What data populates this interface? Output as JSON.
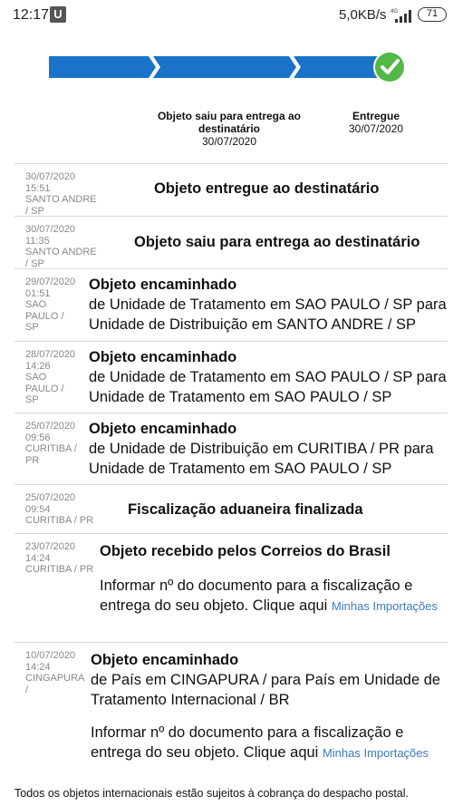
{
  "status_bar": {
    "time": "12:17",
    "app_badge": "U",
    "speed": "5,0KB/s",
    "network": "4G",
    "battery": "71"
  },
  "progress": {
    "completed_segments": 3,
    "total_segments": 3,
    "complete": true,
    "color": "#1a73c8",
    "check_color": "#52b848"
  },
  "steps": [
    {
      "title": "Objeto saiu para entrega ao destinatário",
      "date": "30/07/2020"
    },
    {
      "title": "Entregue",
      "date": "30/07/2020"
    }
  ],
  "events": [
    {
      "date": "30/07/2020",
      "time": "15:51",
      "location": "SANTO ANDRE / SP",
      "title": "Objeto entregue ao destinatário"
    },
    {
      "date": "30/07/2020",
      "time": "11:35",
      "location": "SANTO ANDRE / SP",
      "title": "Objeto saiu para entrega ao destinatário"
    },
    {
      "date": "29/07/2020",
      "time": "01:51",
      "location": "SAO PAULO / SP",
      "title": "Objeto encaminhado",
      "detail": "de Unidade de Tratamento em SAO PAULO / SP para Unidade de Distribuição em SANTO ANDRE / SP"
    },
    {
      "date": "28/07/2020",
      "time": "14:26",
      "location": "SAO PAULO / SP",
      "title": "Objeto encaminhado",
      "detail": "de Unidade de Tratamento em SAO PAULO / SP para Unidade de Tratamento em SAO PAULO / SP"
    },
    {
      "date": "25/07/2020",
      "time": "09:56",
      "location": "CURITIBA / PR",
      "title": "Objeto encaminhado",
      "detail": "de Unidade de Distribuição em CURITIBA / PR para Unidade de Tratamento em SAO PAULO / SP"
    },
    {
      "date": "25/07/2020",
      "time": "09:54",
      "location": "CURITIBA / PR",
      "title": "Fiscalização aduaneira finalizada"
    },
    {
      "date": "23/07/2020",
      "time": "14:24",
      "location": "CURITIBA / PR",
      "title": "Objeto recebido pelos Correios do Brasil",
      "note": "Informar nº do documento para a fiscalização e entrega do seu objeto. Clique aqui",
      "link": "Minhas Importações"
    },
    {
      "date": "10/07/2020",
      "time": "14:24",
      "location": "CINGAPURA /",
      "title": "Objeto encaminhado",
      "detail": "de País em CINGAPURA / para País em Unidade de Tratamento Internacional / BR",
      "note": "Informar nº do documento para a fiscalização e entrega do seu objeto. Clique aqui",
      "link": "Minhas Importações"
    }
  ],
  "footer": "Todos os objetos internacionais estão sujeitos à cobrança do despacho postal."
}
